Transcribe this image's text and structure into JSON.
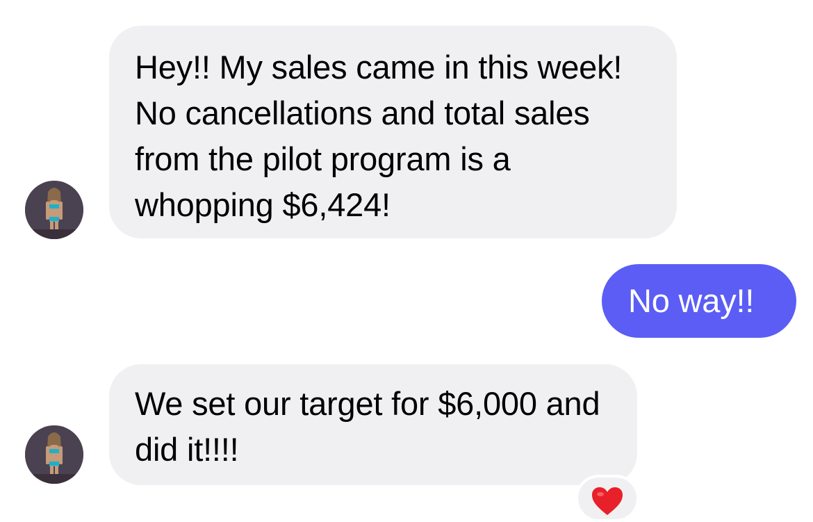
{
  "conversation": {
    "messages": [
      {
        "direction": "incoming",
        "text": "Hey!! My sales came in this week! No cancellations and total sales from the pilot program is a whopping $6,424!"
      },
      {
        "direction": "outgoing",
        "text": "No way!!"
      },
      {
        "direction": "incoming",
        "text": "We set our target for $6,000 and did it!!!!",
        "reaction": "heart-icon"
      }
    ]
  },
  "colors": {
    "incoming_bubble": "#f0f0f2",
    "outgoing_bubble": "#5b5df5",
    "incoming_text": "#000000",
    "outgoing_text": "#ffffff",
    "reaction_heart": "#e8202a"
  }
}
